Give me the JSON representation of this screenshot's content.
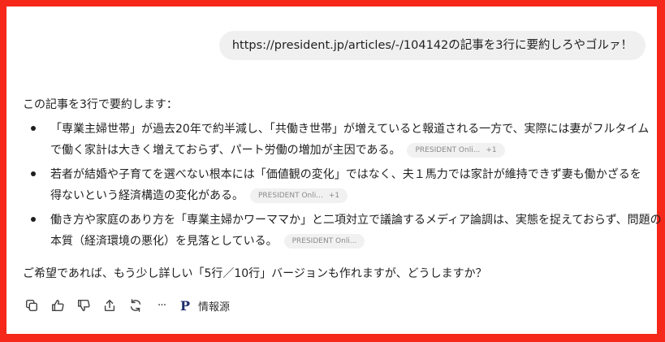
{
  "user_message": "https://president.jp/articles/-/104142の記事を3行に要約しろやゴルァ！",
  "assistant": {
    "intro": "この記事を3行で要約します：",
    "bullets": [
      {
        "line1": "「専業主婦世帯」が過去20年で約半減し、「共働き世帯」が増えていると報道される一方で、実際には妻がフルタイム",
        "line2": "で働く家計は大きく増えておらず、パート労働の増加が主因である。",
        "source": "PRESIDENT Onli...",
        "extra": "+1"
      },
      {
        "line1": "若者が結婚や子育てを選べない根本には「価値観の変化」ではなく、夫１馬力では家計が維持できず妻も働かざるを",
        "line2": "得ないという経済構造の変化がある。",
        "source": "PRESIDENT Onli...",
        "extra": "+1"
      },
      {
        "line1": "働き方や家庭のあり方を「専業主婦かワーママか」と二項対立で議論するメディア論調は、実態を捉えておらず、問題の",
        "line2": "本質（経済環境の悪化）を見落としている。",
        "source": "PRESIDENT Onli...",
        "extra": ""
      }
    ],
    "closing": "ご希望であれば、もう少し詳しい「5行／10行」バージョンも作れますが、どうしますか？"
  },
  "actions": {
    "icons": [
      "copy-icon",
      "thumbs-up-icon",
      "thumbs-down-icon",
      "share-icon",
      "regenerate-icon",
      "more-icon"
    ],
    "more_label": "···",
    "sources_logo": "P",
    "sources_label": "情報源"
  },
  "colors": {
    "frame": "#f5281a",
    "bubble": "#f0f0f0",
    "chip": "#f1f1f1",
    "logo": "#1d2e6b"
  }
}
